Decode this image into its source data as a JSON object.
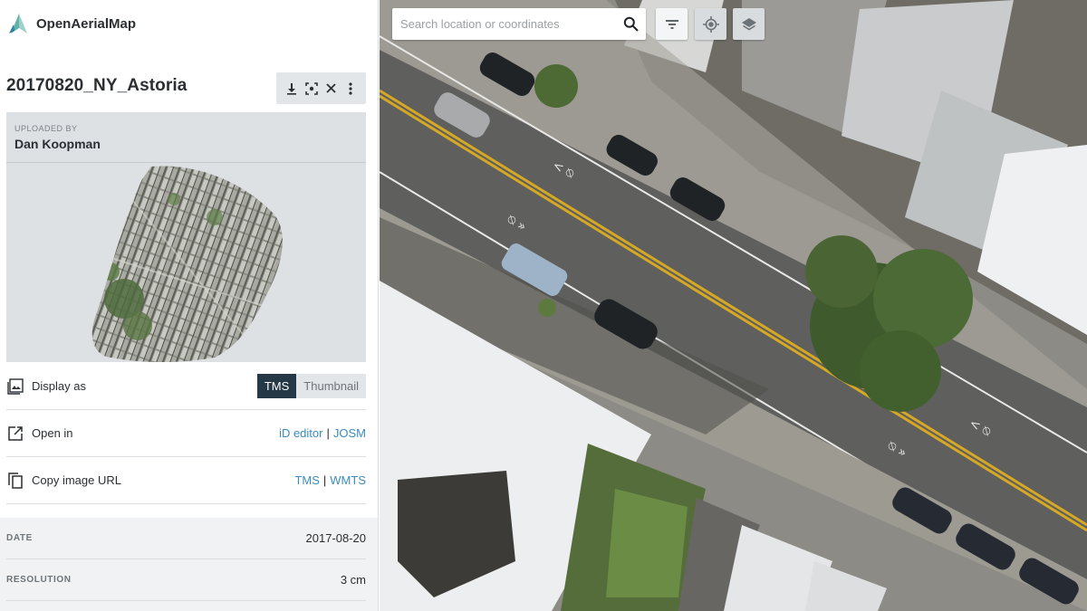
{
  "brand": {
    "name": "OpenAerialMap"
  },
  "image": {
    "title": "20170820_NY_Astoria"
  },
  "uploader": {
    "label": "UPLOADED BY",
    "name": "Dan Koopman"
  },
  "display_as": {
    "label": "Display as",
    "options": [
      "TMS",
      "Thumbnail"
    ],
    "selected": "TMS"
  },
  "open_in": {
    "label": "Open in",
    "links": [
      "iD editor",
      "JOSM"
    ],
    "separator": "|"
  },
  "copy_url": {
    "label": "Copy image URL",
    "links": [
      "TMS",
      "WMTS"
    ],
    "separator": "|"
  },
  "meta": {
    "date_label": "DATE",
    "date_value": "2017-08-20",
    "resolution_label": "RESOLUTION",
    "resolution_value": "3 cm"
  },
  "search": {
    "placeholder": "Search location or coordinates"
  },
  "colors": {
    "accent": "#3a8bbf",
    "toggle_active": "#253846",
    "panel_grey": "#dde1e4"
  },
  "icons": {
    "title_actions": [
      "download-icon",
      "fit-bounds-icon",
      "close-icon",
      "more-vertical-icon"
    ],
    "map_controls": [
      "search-icon",
      "filter-icon",
      "locate-icon",
      "layers-icon"
    ]
  }
}
